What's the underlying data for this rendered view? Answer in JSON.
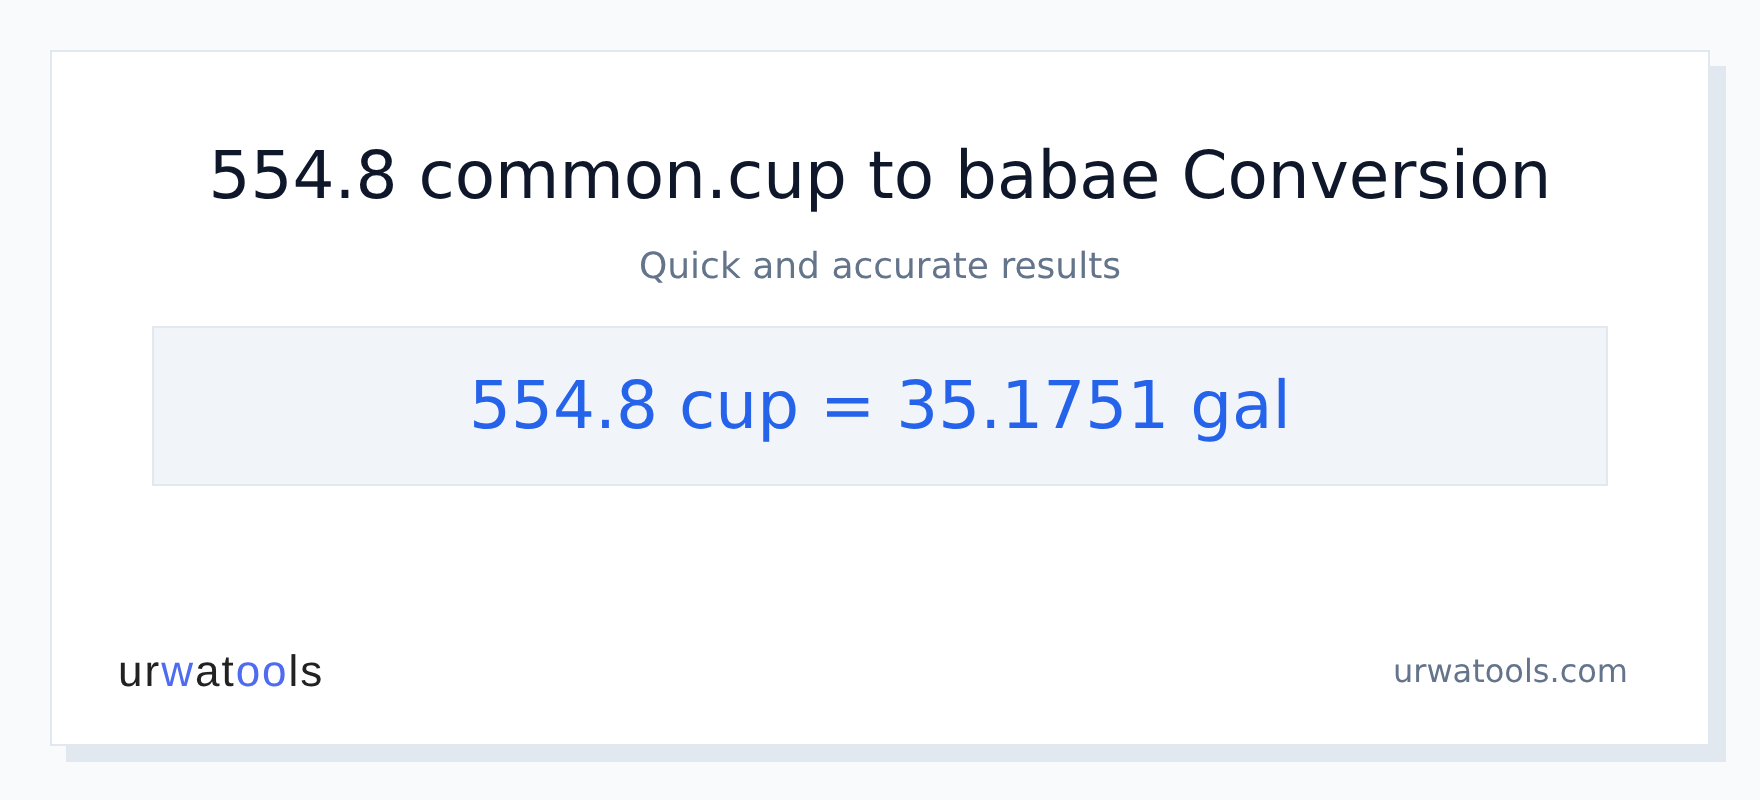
{
  "title": "554.8 common.cup to babae Conversion",
  "subtitle": "Quick and accurate results",
  "result": "554.8 cup = 35.1751 gal",
  "logo": [
    {
      "text": "ur",
      "accent": false
    },
    {
      "text": "w",
      "accent": true
    },
    {
      "text": "at",
      "accent": false
    },
    {
      "text": "oo",
      "accent": true
    },
    {
      "text": "ls",
      "accent": false
    }
  ],
  "site": "urwatools.com"
}
